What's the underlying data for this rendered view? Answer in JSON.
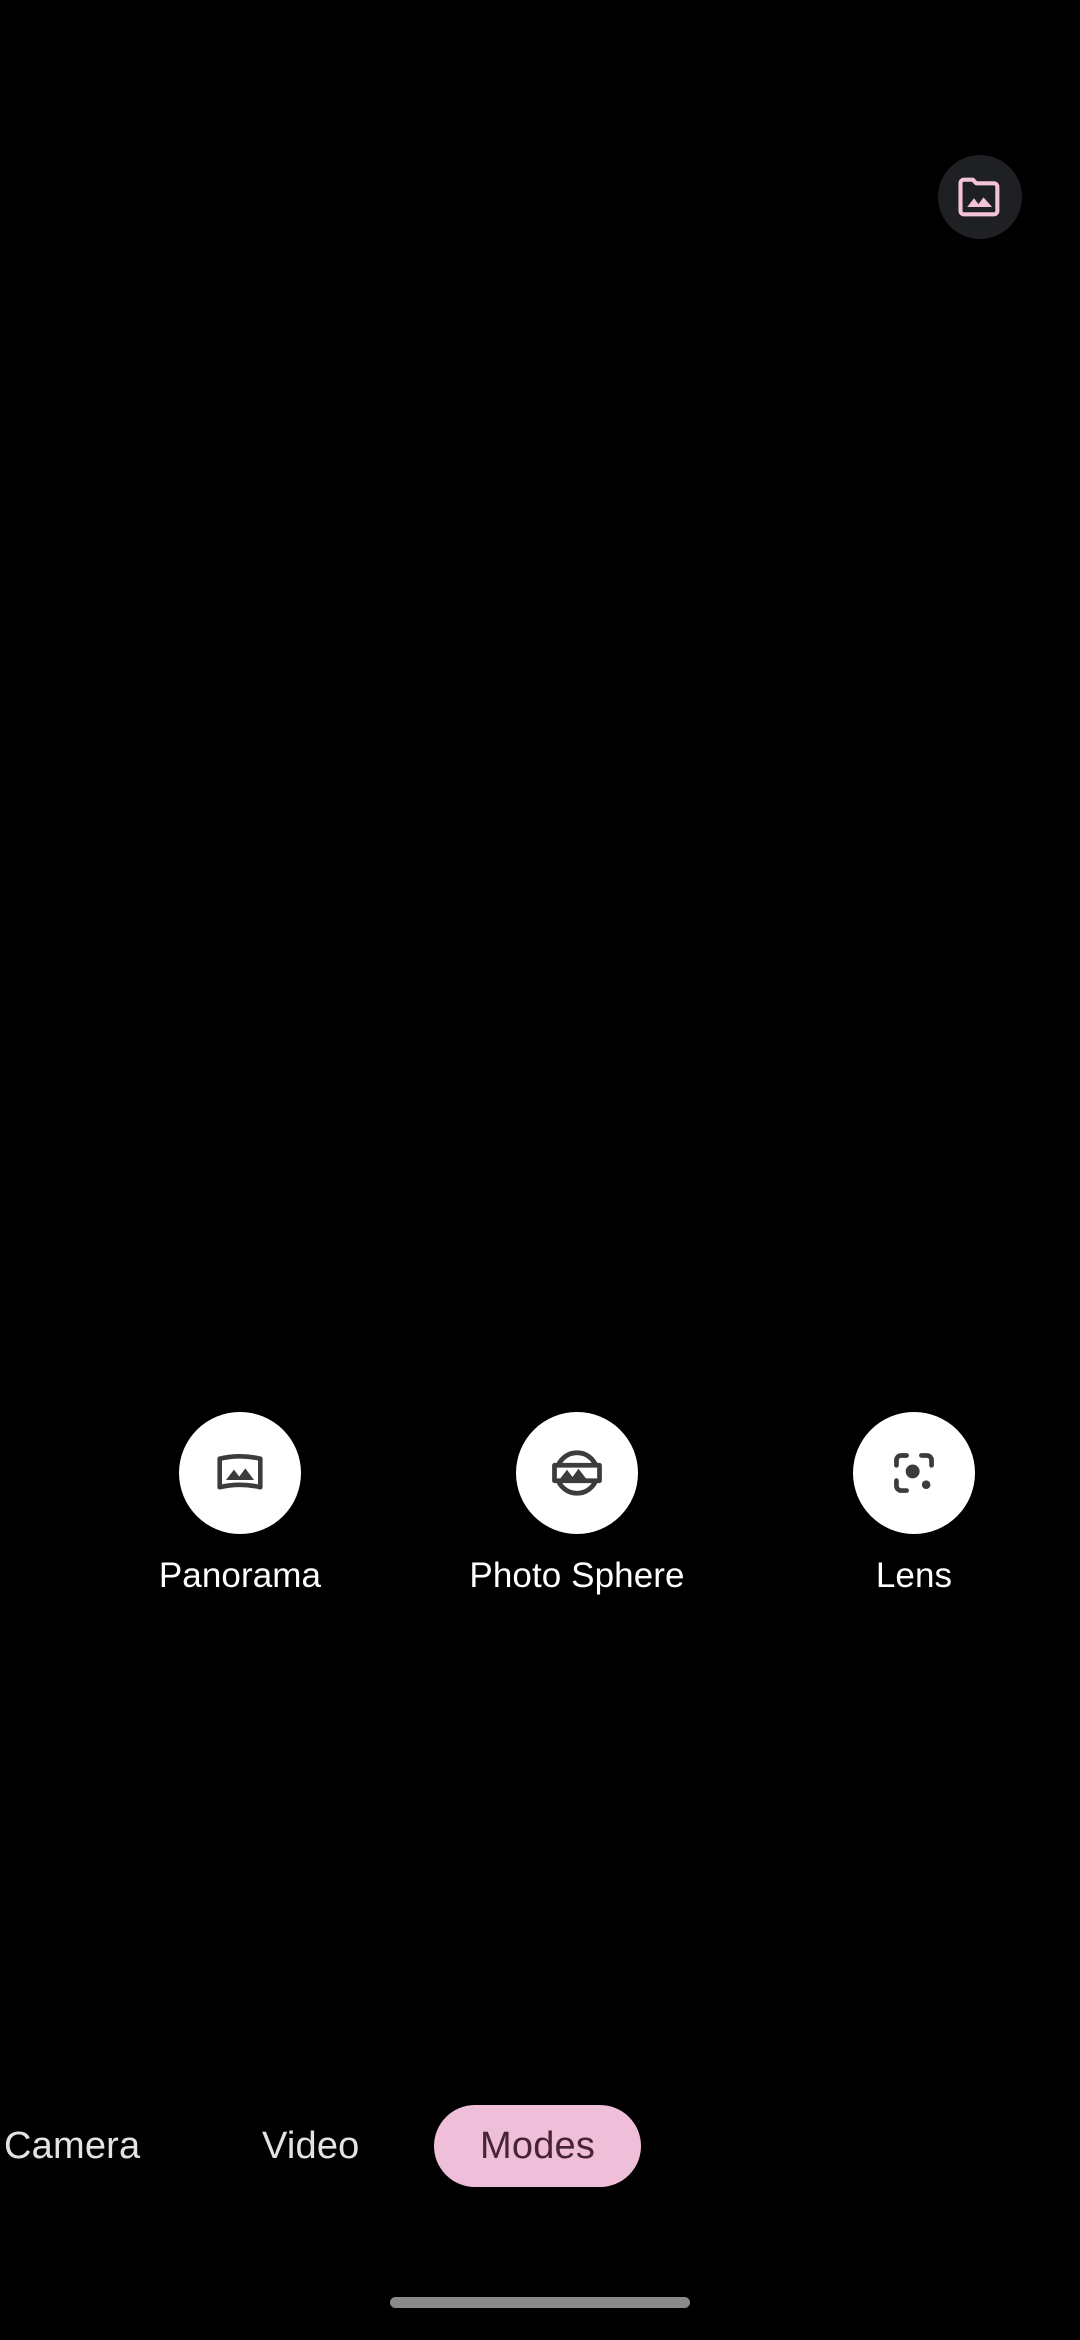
{
  "app": {
    "name": "Camera",
    "screen": "Modes",
    "background_color": "#000000"
  },
  "viewfinder": {
    "state": "black preview"
  },
  "gallery_button": {
    "icon": "photo-library-folder-icon",
    "icon_color": "#F2C3D8",
    "background_color": "#1F2024"
  },
  "modes": {
    "items": [
      {
        "label": "Panorama",
        "icon": "panorama-icon"
      },
      {
        "label": "Photo Sphere",
        "icon": "photo-sphere-icon"
      },
      {
        "label": "Lens",
        "icon": "google-lens-icon"
      }
    ],
    "circle_color": "#FFFFFF",
    "icon_color": "#3C3C3C",
    "label_color": "#FFFFFF"
  },
  "tabs": {
    "items": [
      {
        "label": "Camera",
        "selected": false
      },
      {
        "label": "Video",
        "selected": false
      },
      {
        "label": "Modes",
        "selected": true
      }
    ],
    "selected_background": "#EFBFD9",
    "selected_text_color": "#472437",
    "text_color": "#E4E2E6"
  },
  "system": {
    "gesture_bar_color": "#8A8A8A"
  }
}
